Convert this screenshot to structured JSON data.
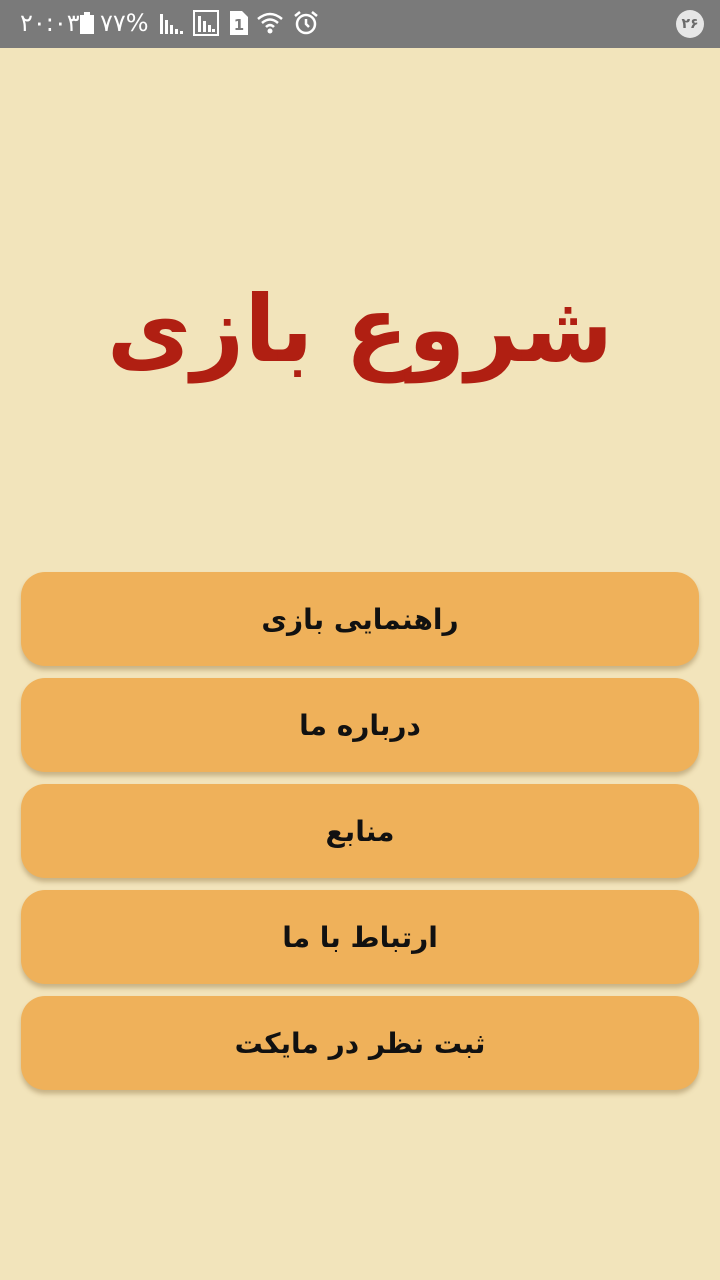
{
  "status_bar": {
    "time": "۲۰:۰۳",
    "battery": "۷۷%",
    "sim_slot": "1",
    "notification_count": "۲۶",
    "icons": [
      "battery-icon",
      "signal-icon",
      "signal-sim-icon",
      "sim-1-icon",
      "wifi-icon",
      "alarm-icon"
    ]
  },
  "title": "شروع بازی",
  "menu": {
    "items": [
      {
        "label": "راهنمایی بازی"
      },
      {
        "label": "درباره ما"
      },
      {
        "label": "منابع"
      },
      {
        "label": "ارتباط با ما"
      },
      {
        "label": "ثبت نظر در مایکت"
      }
    ]
  },
  "colors": {
    "background": "#f2e4bb",
    "status_bar": "#7a7a7a",
    "title": "#b01f12",
    "button": "#efb15a",
    "button_text": "#111111"
  }
}
